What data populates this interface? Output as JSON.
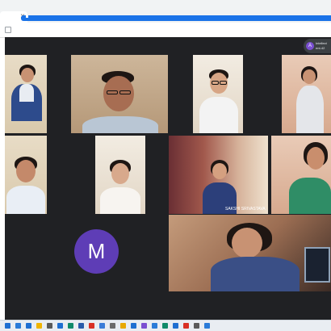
{
  "browser": {
    "tab_close_glyph": "×",
    "new_tab_glyph": "+",
    "address_icon": "page-icon"
  },
  "meeting": {
    "participant_pill": {
      "initial": "A",
      "line1": "Intellect",
      "line2": "ent-42"
    },
    "avatar_initial": "M",
    "tiles": [
      {
        "id": "girl-uniform",
        "caption": ""
      },
      {
        "id": "teacher",
        "caption": ""
      },
      {
        "id": "boy-glasses",
        "caption": ""
      },
      {
        "id": "girl-standing",
        "caption": ""
      },
      {
        "id": "boy-smiling",
        "caption": ""
      },
      {
        "id": "girl-white",
        "caption": ""
      },
      {
        "id": "girl-pink-curtain",
        "caption": "SAKSHI SRIVASTAVA"
      },
      {
        "id": "woman-green",
        "caption": ""
      },
      {
        "id": "girl-laptop",
        "caption": ""
      }
    ]
  },
  "taskbar": {
    "icons": [
      "start-icon",
      "search-icon",
      "taskview-icon",
      "explorer-icon",
      "store-icon",
      "mail-icon",
      "edge-icon",
      "word-icon",
      "chrome-icon",
      "photos-icon",
      "settings-icon",
      "folder-icon",
      "media-icon",
      "app-icon",
      "app-icon-2",
      "app-icon-3",
      "app-icon-4",
      "app-icon-5",
      "app-icon-6",
      "app-icon-7"
    ],
    "colors": [
      "#1f6fd1",
      "#2a7bd8",
      "#1f6fd1",
      "#f0b400",
      "#5a5a5a",
      "#1f6fd1",
      "#0f8a6a",
      "#2a5caa",
      "#d93025",
      "#3b7dd8",
      "#6b6b6b",
      "#e8a800",
      "#1f6fd1",
      "#7a4fd1",
      "#2a7bd8",
      "#0f8a6a",
      "#1f6fd1",
      "#d93025",
      "#5a5a5a",
      "#2a7bd8"
    ]
  }
}
